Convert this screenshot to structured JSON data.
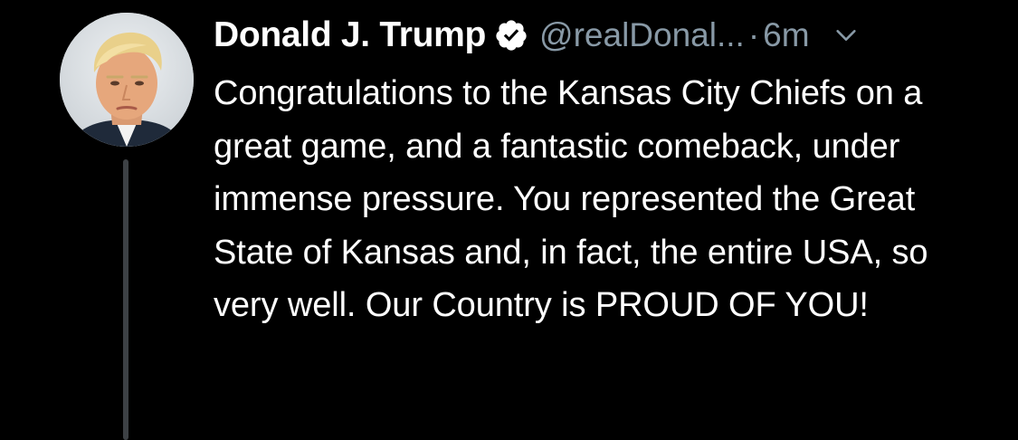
{
  "tweet": {
    "author": {
      "display_name": "Donald J. Trump",
      "handle": "@realDonal...",
      "verified": true,
      "avatar": "profile-photo"
    },
    "separator": "·",
    "timestamp": "6m",
    "text": "Congratulations to the Kansas City Chiefs on a great game, and a fantastic comeback, under immense pressure. You represented the Great State of Kansas and, in fact, the entire USA, so very well. Our Country is PROUD OF YOU!",
    "icons": {
      "verified": "verified-badge-icon",
      "menu": "chevron-down-icon"
    }
  },
  "colors": {
    "background": "#000000",
    "text_primary": "#ffffff",
    "text_secondary": "#8899a6",
    "thread_line": "#3d4145"
  }
}
